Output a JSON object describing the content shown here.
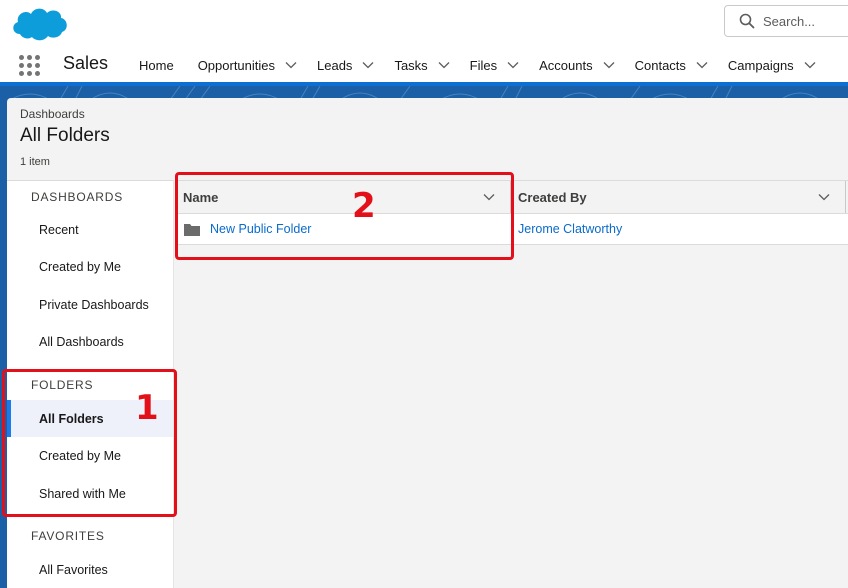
{
  "header": {
    "search_placeholder": "Search...",
    "app_name": "Sales",
    "nav_items": [
      {
        "label": "Home",
        "has_menu": false
      },
      {
        "label": "Opportunities",
        "has_menu": true
      },
      {
        "label": "Leads",
        "has_menu": true
      },
      {
        "label": "Tasks",
        "has_menu": true
      },
      {
        "label": "Files",
        "has_menu": true
      },
      {
        "label": "Accounts",
        "has_menu": true
      },
      {
        "label": "Contacts",
        "has_menu": true
      },
      {
        "label": "Campaigns",
        "has_menu": true
      }
    ]
  },
  "page": {
    "breadcrumb": "Dashboards",
    "title": "All Folders",
    "item_count": "1 item"
  },
  "sidebar": {
    "sections": [
      {
        "heading": "DASHBOARDS",
        "items": [
          "Recent",
          "Created by Me",
          "Private Dashboards",
          "All Dashboards"
        ]
      },
      {
        "heading": "FOLDERS",
        "items": [
          "All Folders",
          "Created by Me",
          "Shared with Me"
        ]
      },
      {
        "heading": "FAVORITES",
        "items": [
          "All Favorites"
        ]
      }
    ],
    "active_item": "All Folders"
  },
  "table": {
    "columns": [
      "Name",
      "Created By"
    ],
    "rows": [
      {
        "name": "New Public Folder",
        "created_by": "Jerome Clatworthy"
      }
    ]
  },
  "annotations": [
    "1",
    "2"
  ],
  "colors": {
    "brand_blue": "#1b5fa6",
    "link": "#0b6bcb",
    "annotation_red": "#e3101a",
    "active_indicator": "#1b7ae6"
  }
}
